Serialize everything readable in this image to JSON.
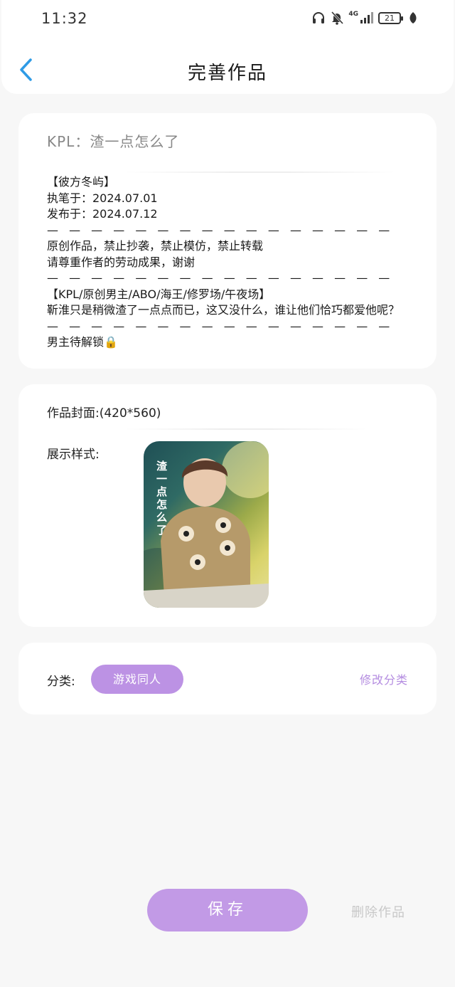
{
  "status_bar": {
    "time": "11:32",
    "network": "4G",
    "battery": "21",
    "icons": [
      "headphones-icon",
      "bell-off-icon",
      "signal-icon",
      "battery-icon",
      "leaf-icon"
    ]
  },
  "header": {
    "title": "完善作品",
    "back_icon": "chevron-left-icon"
  },
  "work": {
    "title": "KPL：渣一点怎么了",
    "description_lines": [
      "【彼方冬屿】",
      "执笔于：2024.07.01",
      "发布于：2024.07.12",
      "— — — — — — — — — — — — — — — — — — — — — — — —",
      "原创作品，禁止抄袭，禁止模仿，禁止转载",
      "请尊重作者的劳动成果，谢谢",
      "— — — — — — — — — — — — — — — — — — — — — — — —",
      "【KPL/原创男主/ABO/海王/修罗场/午夜场】",
      "靳淮只是稍微渣了一点点而已，这又没什么，谁让他们恰巧都爱他呢？",
      "— — — — — — — — — — — — — — — — — — — — — — — —",
      "男主待解锁🔒"
    ]
  },
  "cover": {
    "label": "作品封面:(420*560)",
    "style_label": "展示样式:",
    "image_text": "渣一点怎么了"
  },
  "category": {
    "label": "分类:",
    "value": "游戏同人",
    "edit_label": "修改分类"
  },
  "actions": {
    "save_label": "保存",
    "delete_label": "删除作品"
  },
  "colors": {
    "accent": "#bc92e4",
    "save_button": "#c29ae6",
    "back_arrow": "#2e9be6",
    "background": "#f7f7f7"
  }
}
